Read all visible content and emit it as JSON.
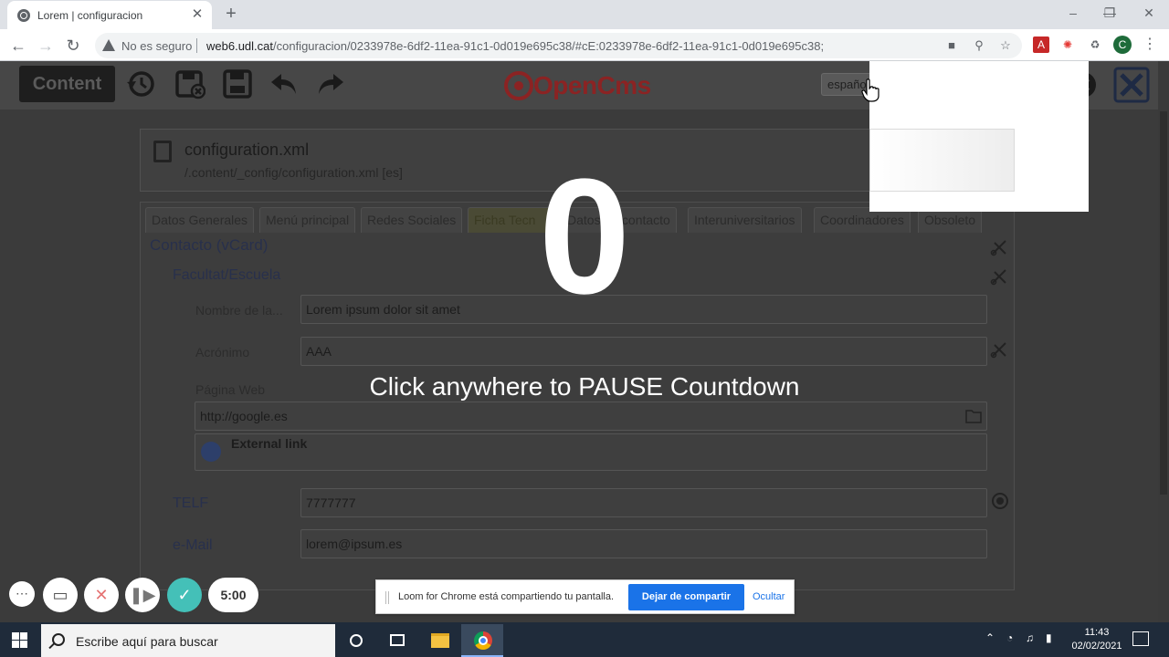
{
  "browser": {
    "tab_title": "Lorem | configuracion",
    "tab_close": "✕",
    "new_tab": "+",
    "insecure_label": "No es seguro",
    "url_host": "web6.udl.cat",
    "url_path": "/configuracion/0233978e-6df2-11ea-91c1-0d019e695c38/#cE:0233978e-6df2-11ea-91c1-0d019e695c38;",
    "profile_initial": "C"
  },
  "toolbar": {
    "content_label": "Content",
    "language_value": "español"
  },
  "file": {
    "name": "configuration.xml",
    "path": "/.content/_config/configuration.xml",
    "locale": "[es]"
  },
  "tabs": [
    {
      "label": "Datos Generales"
    },
    {
      "label": "Menú principal"
    },
    {
      "label": "Redes Sociales"
    },
    {
      "label": "Ficha Tecn"
    },
    {
      "label": "Datos de contacto"
    },
    {
      "label": "Interuniversitarios"
    },
    {
      "label": "Coordinadores"
    },
    {
      "label": "Obsoleto"
    }
  ],
  "form": {
    "section_title": "Contacto (vCard)",
    "subsection_title": "Facultat/Escuela",
    "fields": {
      "nombre_label": "Nombre de la...",
      "nombre_value": "Lorem ipsum dolor sit amet",
      "acronimo_label": "Acrónimo",
      "acronimo_value": "AAA",
      "web_label": "Página Web",
      "web_value": "http://google.es",
      "link_label": "External link",
      "telf_label": "TELF",
      "telf_value": "7777777",
      "email_label": "e-Mail",
      "email_value": "lorem@ipsum.es"
    }
  },
  "overlay": {
    "countdown": "0",
    "pause_text": "Click anywhere to PAUSE Countdown"
  },
  "loom": {
    "timer": "5:00",
    "share_message": "Loom for Chrome está compartiendo tu pantalla.",
    "stop_button": "Dejar de compartir",
    "hide_button": "Ocultar"
  },
  "taskbar": {
    "search_placeholder": "Escribe aquí para buscar",
    "time": "11:43",
    "date": "02/02/2021"
  }
}
